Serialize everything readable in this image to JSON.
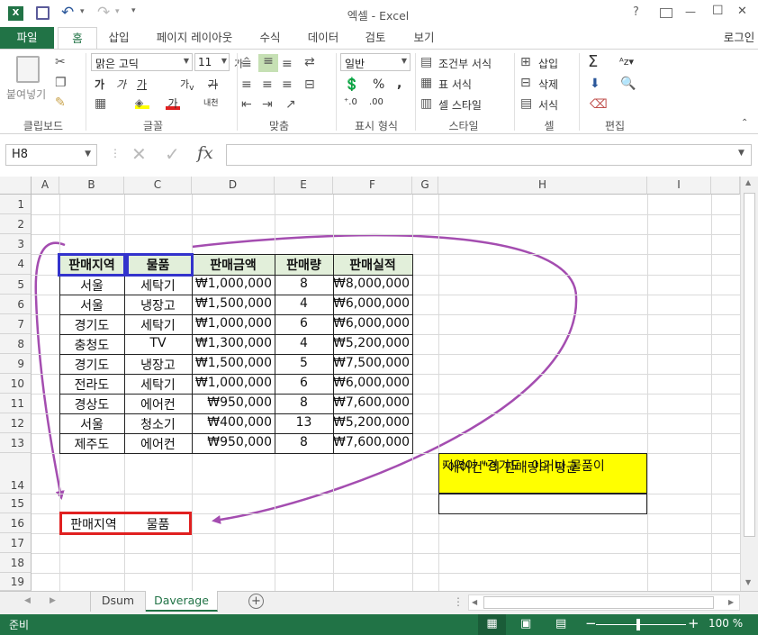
{
  "window": {
    "title": "엑셀 - Excel",
    "help": "?",
    "minimize": "—",
    "maximize": "☐",
    "close": "✕"
  },
  "tabs": [
    "파일",
    "홈",
    "삽입",
    "페이지 레이아웃",
    "수식",
    "데이터",
    "검토",
    "보기"
  ],
  "login": "로그인",
  "ribbon": {
    "paste": "붙여넣기",
    "clipboard": "클립보드",
    "font_name": "맑은 고딕",
    "font_size": "11",
    "font_group": "글꼴",
    "align_group": "맞춤",
    "number_format": "일반",
    "number_group": "표시 형식",
    "cond_format": "조건부 서식",
    "table_format": "표 서식",
    "cell_style": "셀 스타일",
    "style_group": "스타일",
    "insert": "삽입",
    "delete": "삭제",
    "format": "서식",
    "cells_group": "셀",
    "edit_group": "편집"
  },
  "formula": {
    "namebox": "H8",
    "fx": "fx",
    "value": ""
  },
  "columns": [
    "A",
    "B",
    "C",
    "D",
    "E",
    "F",
    "G",
    "H",
    "I"
  ],
  "rows": [
    "1",
    "2",
    "3",
    "4",
    "5",
    "6",
    "7",
    "8",
    "9",
    "10",
    "11",
    "12",
    "13",
    "14",
    "15",
    "16",
    "17",
    "18",
    "19"
  ],
  "table": {
    "headers": [
      "판매지역",
      "물품",
      "판매금액",
      "판매량",
      "판매실적"
    ],
    "rows": [
      [
        "서울",
        "세탁기",
        "₩1,000,000",
        "8",
        "₩8,000,000"
      ],
      [
        "서울",
        "냉장고",
        "₩1,500,000",
        "4",
        "₩6,000,000"
      ],
      [
        "경기도",
        "세탁기",
        "₩1,000,000",
        "6",
        "₩6,000,000"
      ],
      [
        "충청도",
        "TV",
        "₩1,300,000",
        "4",
        "₩5,200,000"
      ],
      [
        "경기도",
        "냉장고",
        "₩1,500,000",
        "5",
        "₩7,500,000"
      ],
      [
        "전라도",
        "세탁기",
        "₩1,000,000",
        "6",
        "₩6,000,000"
      ],
      [
        "경상도",
        "에어컨",
        "₩950,000",
        "8",
        "₩7,600,000"
      ],
      [
        "서울",
        "청소기",
        "₩400,000",
        "13",
        "₩5,200,000"
      ],
      [
        "제주도",
        "에어컨",
        "₩950,000",
        "8",
        "₩7,600,000"
      ]
    ]
  },
  "criteria": {
    "b16": "판매지역",
    "c16": "물품"
  },
  "note": {
    "line1": "지역이 \"경기도\" 이거나 물품이",
    "line2": "\"에어컨\"의 판매량의 평균",
    "highlight": "#ffff00"
  },
  "sheets": [
    "Dsum",
    "Daverage"
  ],
  "status": {
    "ready": "준비",
    "zoom": "100 %"
  },
  "colors": {
    "excel_green": "#217346",
    "header_fill": "#e2efda",
    "blue_box": "#3333cc",
    "red_box": "#e02020",
    "arrow": "#a44db0"
  }
}
